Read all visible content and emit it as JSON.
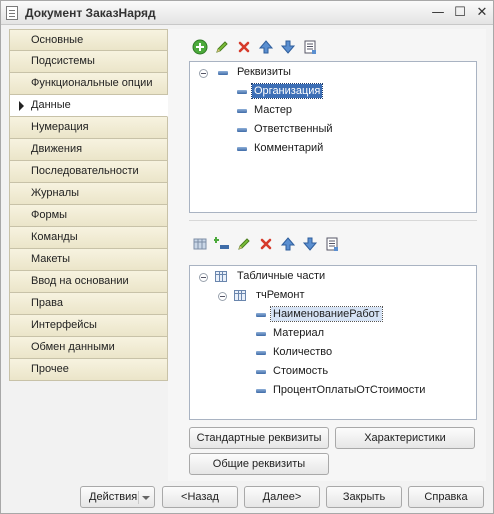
{
  "window": {
    "title": "Документ ЗаказНаряд",
    "controls": {
      "minimize": "—",
      "maximize": "☐",
      "close": "✕"
    }
  },
  "sidebar": {
    "items": [
      {
        "label": "Основные",
        "active": false
      },
      {
        "label": "Подсистемы",
        "active": false
      },
      {
        "label": "Функциональные опции",
        "active": false
      },
      {
        "label": "Данные",
        "active": true
      },
      {
        "label": "Нумерация",
        "active": false
      },
      {
        "label": "Движения",
        "active": false
      },
      {
        "label": "Последовательности",
        "active": false
      },
      {
        "label": "Журналы",
        "active": false
      },
      {
        "label": "Формы",
        "active": false
      },
      {
        "label": "Команды",
        "active": false
      },
      {
        "label": "Макеты",
        "active": false
      },
      {
        "label": "Ввод на основании",
        "active": false
      },
      {
        "label": "Права",
        "active": false
      },
      {
        "label": "Интерфейсы",
        "active": false
      },
      {
        "label": "Обмен данными",
        "active": false
      },
      {
        "label": "Прочее",
        "active": false
      }
    ]
  },
  "top_toolbar": {
    "buttons": [
      "add-icon",
      "edit-icon",
      "delete-icon",
      "move-up-icon",
      "move-down-icon",
      "list-icon"
    ]
  },
  "attributes_tree": {
    "root": "Реквизиты",
    "items": [
      "Организация",
      "Мастер",
      "Ответственный",
      "Комментарий"
    ],
    "selected": "Организация"
  },
  "bottom_toolbar": {
    "buttons": [
      "add-table-icon",
      "add-field-icon",
      "edit-icon",
      "delete-icon",
      "move-up-icon",
      "move-down-icon",
      "list-icon"
    ]
  },
  "tabular_tree": {
    "root": "Табличные части",
    "table": "тчРемонт",
    "items": [
      "НаименованиеРабот",
      "Материал",
      "Количество",
      "Стоимость",
      "ПроцентОплатыОтСтоимости"
    ],
    "selected": "НаименованиеРабот"
  },
  "panel_buttons": {
    "standard_attributes": "Стандартные реквизиты",
    "characteristics": "Характеристики",
    "common_attributes": "Общие реквизиты"
  },
  "footer": {
    "actions": "Действия",
    "back": "<Назад",
    "next": "Далее>",
    "close": "Закрыть",
    "help": "Справка"
  }
}
